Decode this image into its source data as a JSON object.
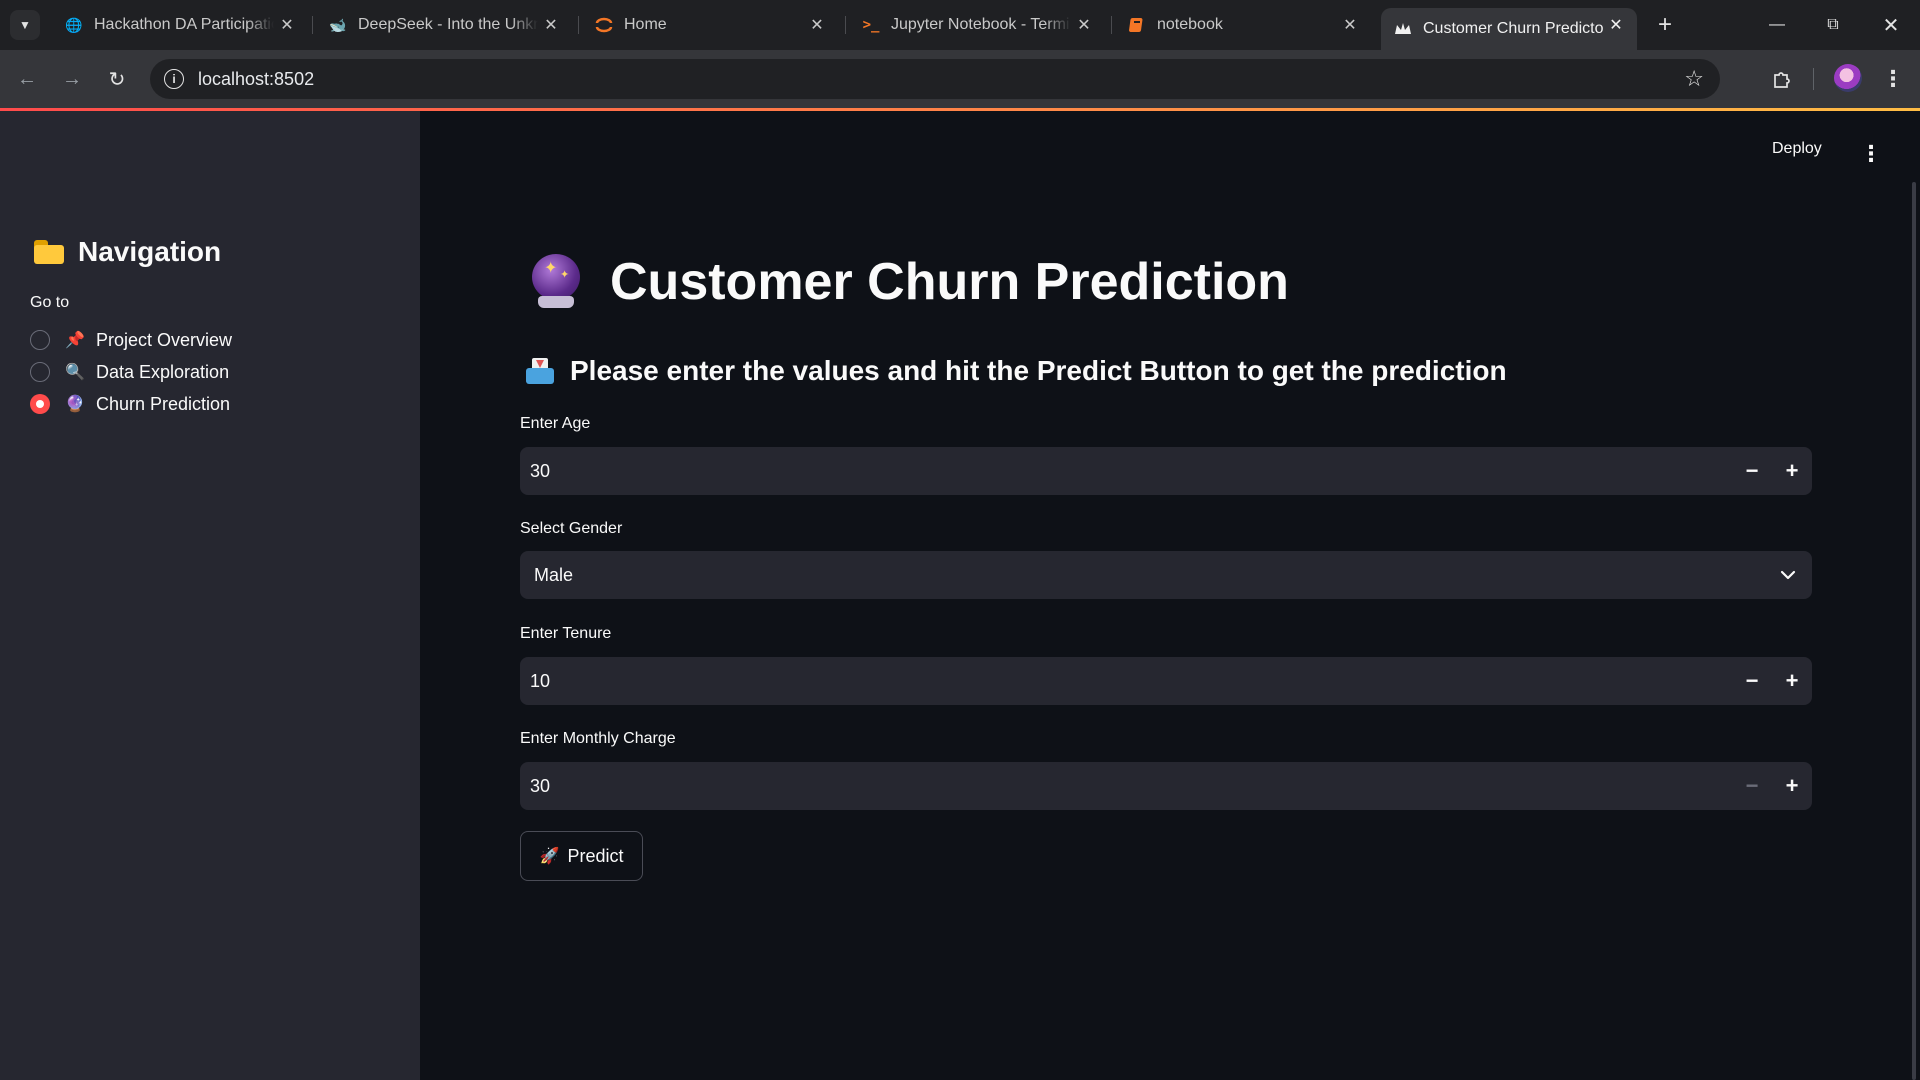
{
  "browser": {
    "tabs": [
      {
        "title": "Hackathon DA Participation",
        "icon": "globe-icon",
        "active": false
      },
      {
        "title": "DeepSeek - Into the Unknown",
        "icon": "deepseek-whale-icon",
        "active": false
      },
      {
        "title": "Home",
        "icon": "jupyter-icon",
        "active": false
      },
      {
        "title": "Jupyter Notebook - Terminal",
        "icon": "terminal-icon",
        "active": false
      },
      {
        "title": "notebook",
        "icon": "notebook-icon",
        "active": false
      },
      {
        "title": "Customer Churn Predictor",
        "icon": "streamlit-crown-icon",
        "active": true
      }
    ],
    "url": "localhost:8502"
  },
  "app": {
    "accent_color": "#ff4b4b",
    "header": {
      "deploy_label": "Deploy"
    }
  },
  "sidebar": {
    "title": "Navigation",
    "goto_label": "Go to",
    "options": [
      {
        "emoji": "📌",
        "label": "Project Overview",
        "selected": false
      },
      {
        "emoji": "🔍",
        "label": "Data Exploration",
        "selected": false
      },
      {
        "emoji": "🔮",
        "label": "Churn Prediction",
        "selected": true
      }
    ]
  },
  "main": {
    "title": "Customer Churn Prediction",
    "subtitle": "Please enter the values and hit the Predict Button to get the prediction",
    "fields": {
      "age": {
        "label": "Enter Age",
        "value": "30"
      },
      "gender": {
        "label": "Select Gender",
        "value": "Male"
      },
      "tenure": {
        "label": "Enter Tenure",
        "value": "10"
      },
      "monthly_charge": {
        "label": "Enter Monthly Charge",
        "value": "30"
      }
    },
    "predict_button": {
      "emoji": "🚀",
      "label": "Predict"
    }
  }
}
